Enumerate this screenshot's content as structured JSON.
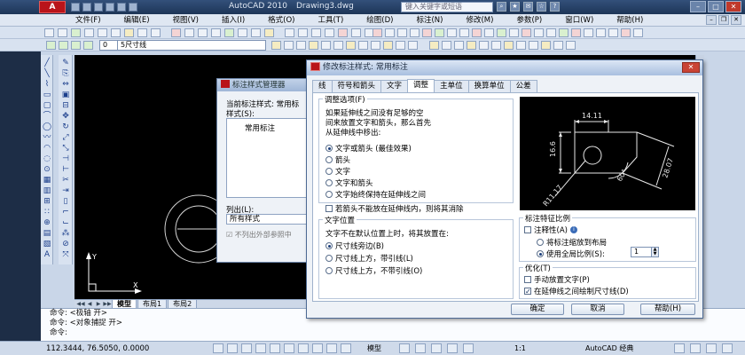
{
  "app": {
    "title": "AutoCAD 2010",
    "document": "Drawing3.dwg",
    "logo": "A",
    "search_placeholder": "键入关键字或短语"
  },
  "menu": [
    "文件(F)",
    "编辑(E)",
    "视图(V)",
    "插入(I)",
    "格式(O)",
    "工具(T)",
    "绘图(D)",
    "标注(N)",
    "修改(M)",
    "参数(P)",
    "窗口(W)",
    "帮助(H)"
  ],
  "toolbar": {
    "layer_combo": "0",
    "style_combo": "5尺寸线"
  },
  "layout_tabs": [
    "模型",
    "布局1",
    "布局2"
  ],
  "command_lines": [
    "命令: <极轴 开>",
    "命令: <对象捕捉 开>",
    "命令:"
  ],
  "status": {
    "coords": "112.3444, 76.5050, 0.0000",
    "model": "模型",
    "scale": "1:1",
    "workspace": "AutoCAD 经典"
  },
  "manager_dialog": {
    "title": "标注样式管理器",
    "current_style": "当前标注样式: 常用标",
    "styles_label": "样式(S):",
    "style_item": "常用标注",
    "list_label": "列出(L):",
    "list_value": "所有样式",
    "xref_checkbox": "不列出外部参照中"
  },
  "dialog": {
    "title": "修改标注样式: 常用标注",
    "close": "✕",
    "tabs": [
      "线",
      "符号和箭头",
      "文字",
      "调整",
      "主单位",
      "换算单位",
      "公差"
    ],
    "active_tab": "调整",
    "fit_options": {
      "title": "调整选项(F)",
      "description": [
        "如果延伸线之间没有足够的空",
        "间来放置文字和箭头，那么首先",
        "从延伸线中移出:"
      ],
      "options": [
        "文字或箭头 (最佳效果)",
        "箭头",
        "文字",
        "文字和箭头",
        "文字始终保持在延伸线之间"
      ],
      "selected": 0,
      "suppress_checkbox": "若箭头不能放在延伸线内，则将其消除"
    },
    "text_placement": {
      "title": "文字位置",
      "description": "文字不在默认位置上时，将其放置在:",
      "options": [
        "尺寸线旁边(B)",
        "尺寸线上方，带引线(L)",
        "尺寸线上方，不带引线(O)"
      ],
      "selected": 0
    },
    "scale": {
      "title": "标注特征比例",
      "annotative_label": "注释性(A)",
      "annotative_checked": false,
      "options": [
        "将标注缩放到布局",
        "使用全局比例(S):"
      ],
      "selected": 1,
      "global_scale": "1"
    },
    "finetune": {
      "title": "优化(T)",
      "manual_label": "手动放置文字(P)",
      "manual_checked": false,
      "draw_label": "在延伸线之间绘制尺寸线(D)",
      "draw_checked": true
    },
    "preview": {
      "labels": [
        "14.11",
        "16.6",
        "28.07",
        "60°",
        "R11.17"
      ]
    },
    "buttons": {
      "ok": "确定",
      "cancel": "取消",
      "help": "帮助(H)"
    }
  }
}
